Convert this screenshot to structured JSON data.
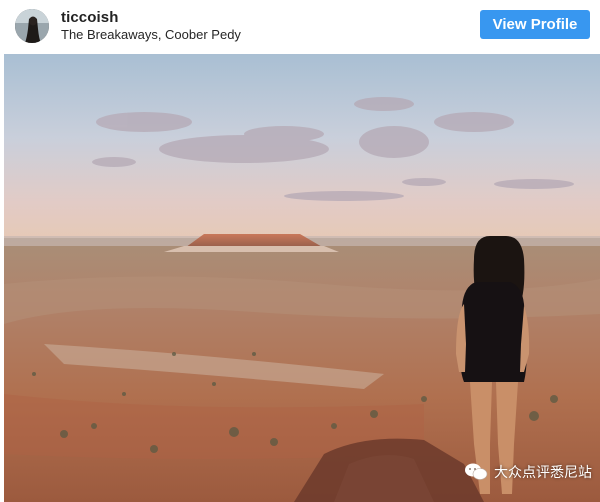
{
  "post_header": {
    "username": "ticcoish",
    "location": "The Breakaways, Coober Pedy",
    "view_profile_label": "View Profile",
    "accent_color": "#3897f0"
  },
  "photo": {
    "watermark_text": "大众点评悉尼站",
    "watermark_icon": "wechat-icon"
  }
}
